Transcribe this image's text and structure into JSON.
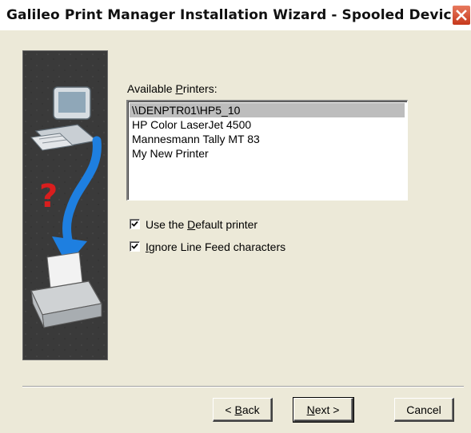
{
  "window": {
    "title": "Galileo Print Manager Installation Wizard - Spooled Device"
  },
  "printers": {
    "label_prefix": "Available ",
    "label_mnemonic": "P",
    "label_suffix": "rinters:",
    "items": [
      {
        "name": "\\\\DENPTR01\\HP5_10",
        "selected": true
      },
      {
        "name": "HP Color LaserJet 4500",
        "selected": false
      },
      {
        "name": "Mannesmann Tally MT 83",
        "selected": false
      },
      {
        "name": "My New Printer",
        "selected": false
      }
    ]
  },
  "options": {
    "default_printer": {
      "label_prefix": "Use the ",
      "label_mnemonic": "D",
      "label_suffix": "efault printer",
      "checked": true
    },
    "ignore_line_feed": {
      "label_prefix": "",
      "label_mnemonic": "I",
      "label_suffix": "gnore Line Feed characters",
      "checked": true
    }
  },
  "buttons": {
    "back": {
      "prefix": "< ",
      "mnemonic": "B",
      "suffix": "ack"
    },
    "next": {
      "prefix": "",
      "mnemonic": "N",
      "suffix": "ext >"
    },
    "cancel": {
      "label": "Cancel"
    }
  },
  "colors": {
    "dialog_bg": "#ece9d8",
    "selection": "#bdbdbd",
    "close_button": "#d54a2c"
  },
  "icons": [
    "close-icon",
    "computer-icon",
    "question-mark-icon",
    "arrow-icon",
    "printer-icon",
    "checkmark-icon"
  ]
}
